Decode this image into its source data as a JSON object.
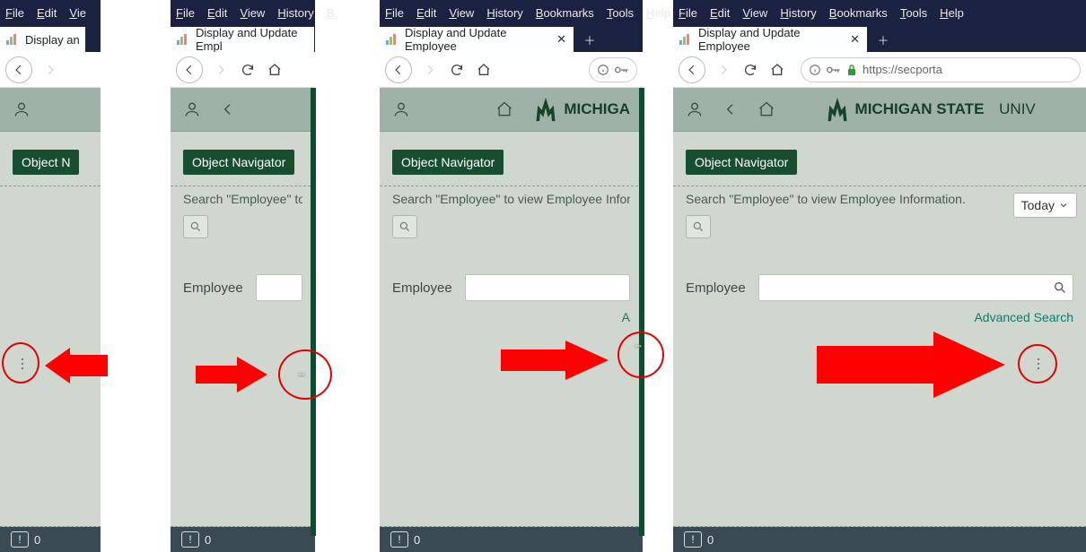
{
  "menus": {
    "file": "File",
    "edit": "Edit",
    "view": "View",
    "history": "History",
    "bookmarks": "Bookmarks",
    "tools": "Tools",
    "help": "Help"
  },
  "menus_truncated": {
    "view_short": "Vie",
    "bookmarks_short": "B"
  },
  "tab": {
    "title_full": "Display and Update Employee",
    "title_p1": "Display an",
    "title_p2": "Display and Update Empl",
    "title_p3": "Display and Update Employee"
  },
  "url": {
    "text": "https://secporta"
  },
  "brand": {
    "name": "MICHIGAN STATE",
    "uni": "UNIV",
    "short": "MICHIGA"
  },
  "objnav": {
    "label_full": "Object Navigator",
    "label_short": "Object N"
  },
  "hint": {
    "p1": "",
    "p234": "Search \"Employee\" to view Employee Information.",
    "p2": "Search \"Employee\" to vie",
    "p3": "Search \"Employee\" to view Employee Informat"
  },
  "employee_label": "Employee",
  "advanced": "Advanced Search",
  "today": "Today",
  "footer_count": "0"
}
